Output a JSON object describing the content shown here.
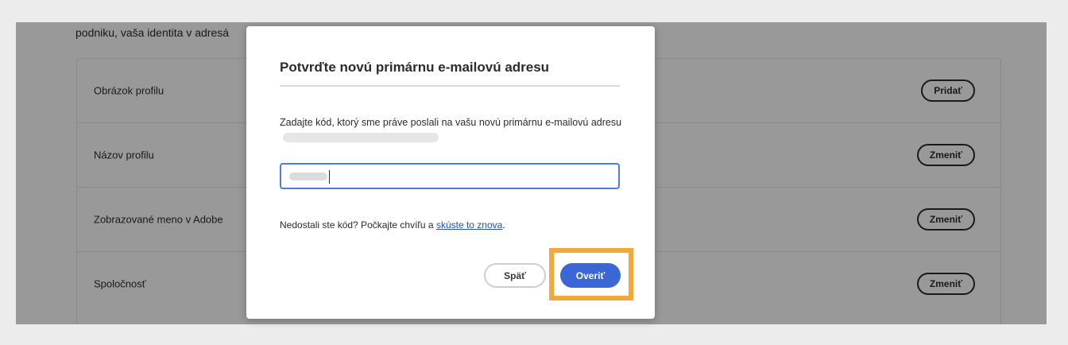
{
  "page": {
    "intro_text": "podniku, vaša identita v adresá"
  },
  "profile": {
    "rows": [
      {
        "label": "Obrázok profilu",
        "action": "Pridať"
      },
      {
        "label": "Názov profilu",
        "action": "Zmeniť"
      },
      {
        "label": "Zobrazované meno v Adobe",
        "action": "Zmeniť"
      },
      {
        "label": "Spoločnosť",
        "action": "Zmeniť"
      }
    ]
  },
  "modal": {
    "title": "Potvrďte novú primárnu e-mailovú adresu",
    "description": "Zadajte kód, ktorý sme práve poslali na vašu novú primárnu e-mailovú adresu",
    "resend_prefix": "Nedostali ste kód? Počkajte chvíľu a ",
    "resend_link": "skúste to znova",
    "resend_suffix": ".",
    "back_label": "Späť",
    "verify_label": "Overiť"
  },
  "colors": {
    "accent": "#3b66d6",
    "highlight": "#f4a83b",
    "link": "#1f4fc1"
  }
}
